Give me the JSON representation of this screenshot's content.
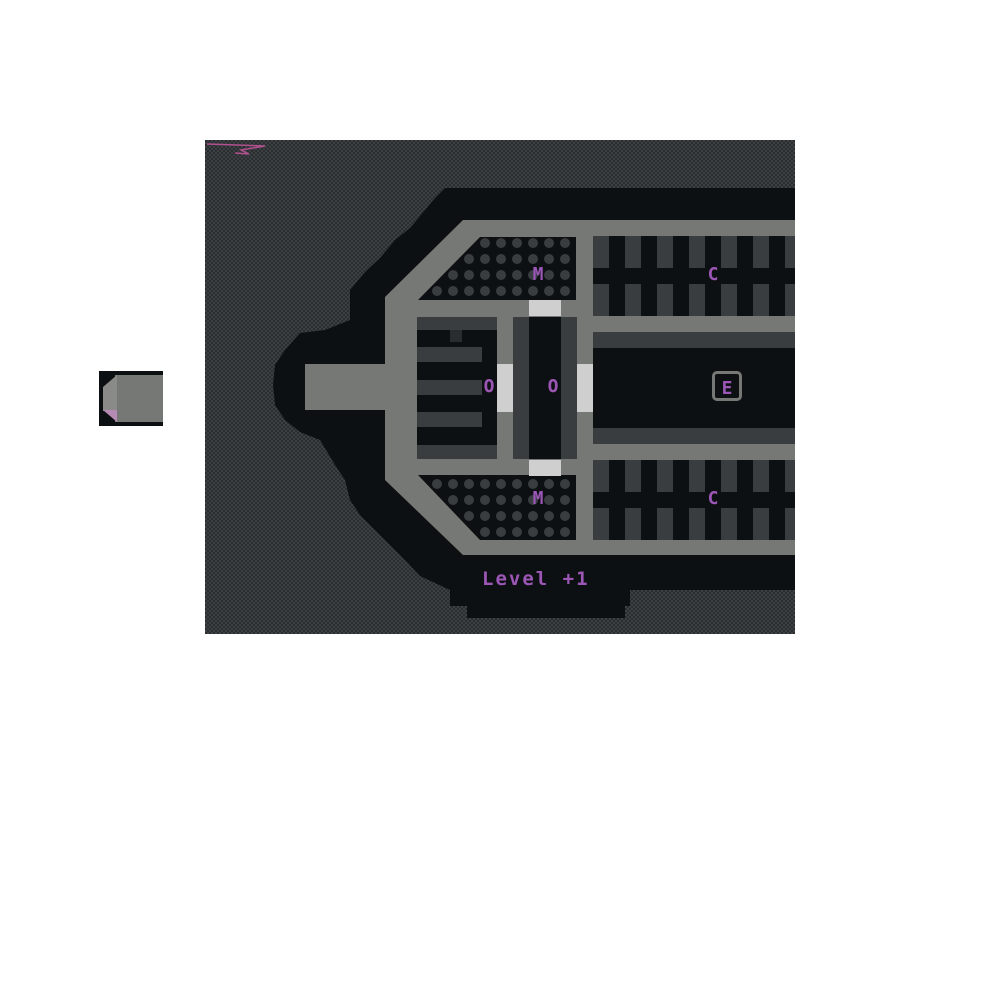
{
  "map": {
    "level_label": "Level +1",
    "rooms": {
      "medbay_top": "M",
      "medbay_bottom": "M",
      "crew_top": "C",
      "crew_bottom": "C",
      "oxygen_left": "O",
      "oxygen_center": "O",
      "engine": "E"
    }
  },
  "colors": {
    "space_dark": "#2a2d30",
    "space_light": "#3e4144",
    "hull_outline": "#0d1012",
    "hull": "#767875",
    "room_floor": "#0d1012",
    "label": "#9b56b6",
    "door": "#cfcfcf"
  },
  "icons": {
    "mini_ship": "mini-ship-icon",
    "pointer": "arrow-pointer-icon"
  }
}
